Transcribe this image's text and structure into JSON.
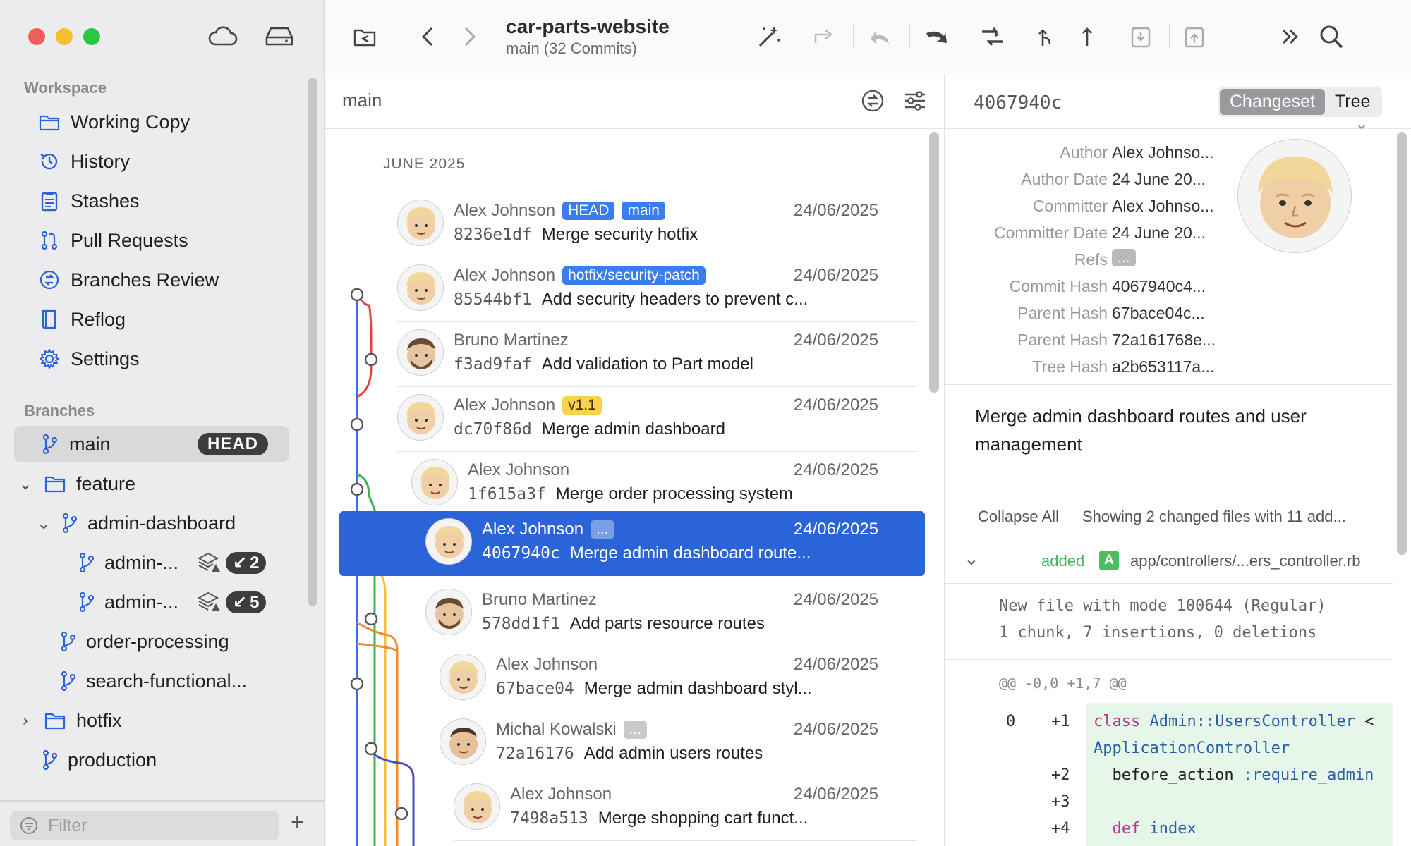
{
  "sidebar": {
    "workspace_label": "Workspace",
    "workspace_items": [
      {
        "label": "Working Copy"
      },
      {
        "label": "History"
      },
      {
        "label": "Stashes"
      },
      {
        "label": "Pull Requests"
      },
      {
        "label": "Branches Review"
      },
      {
        "label": "Reflog"
      },
      {
        "label": "Settings"
      }
    ],
    "branches_label": "Branches",
    "branches": {
      "main": {
        "label": "main",
        "badge": "HEAD"
      },
      "feature": {
        "label": "feature"
      },
      "admin_dashboard": {
        "label": "admin-dashboard"
      },
      "admin_sub1": {
        "label": "admin-...",
        "count": "2"
      },
      "admin_sub2": {
        "label": "admin-...",
        "count": "5"
      },
      "order_processing": {
        "label": "order-processing"
      },
      "search_functional": {
        "label": "search-functional..."
      },
      "hotfix": {
        "label": "hotfix"
      },
      "production": {
        "label": "production"
      }
    },
    "filter_placeholder": "Filter",
    "accent_color": "#2b63d9"
  },
  "toolbar": {
    "repo_name": "car-parts-website",
    "repo_subtitle": "main (32 Commits)"
  },
  "list": {
    "branch": "main",
    "month": "JUNE 2025",
    "commits": [
      {
        "author": "Alex Johnson",
        "tags": [
          "HEAD",
          "main"
        ],
        "date": "24/06/2025",
        "hash": "8236e1df",
        "message": "Merge security hotfix"
      },
      {
        "author": "Alex Johnson",
        "tags": [
          "hotfix/security-patch"
        ],
        "date": "24/06/2025",
        "hash": "85544bf1",
        "message": "Add security headers to prevent c..."
      },
      {
        "author": "Bruno Martinez",
        "tags": [],
        "date": "24/06/2025",
        "hash": "f3ad9faf",
        "message": "Add validation to Part model"
      },
      {
        "author": "Alex Johnson",
        "tags": [
          "v1.1"
        ],
        "date": "24/06/2025",
        "hash": "dc70f86d",
        "message": "Merge admin dashboard"
      },
      {
        "author": "Alex Johnson",
        "tags": [],
        "date": "24/06/2025",
        "hash": "1f615a3f",
        "message": "Merge order processing system"
      },
      {
        "author": "Alex Johnson",
        "tags": [
          "..."
        ],
        "date": "24/06/2025",
        "hash": "4067940c",
        "message": "Merge admin dashboard route..."
      },
      {
        "author": "Bruno Martinez",
        "tags": [],
        "date": "24/06/2025",
        "hash": "578dd1f1",
        "message": "Add parts resource routes"
      },
      {
        "author": "Alex Johnson",
        "tags": [],
        "date": "24/06/2025",
        "hash": "67bace04",
        "message": "Merge admin dashboard styl..."
      },
      {
        "author": "Michal Kowalski",
        "tags": [
          "..."
        ],
        "date": "24/06/2025",
        "hash": "72a16176",
        "message": "Add admin users routes"
      },
      {
        "author": "Alex Johnson",
        "tags": [],
        "date": "24/06/2025",
        "hash": "7498a513",
        "message": "Merge shopping cart funct..."
      }
    ]
  },
  "detail": {
    "hash": "4067940c",
    "tab_changeset": "Changeset",
    "tab_tree": "Tree",
    "meta": [
      {
        "label": "Author",
        "value": "Alex Johnso..."
      },
      {
        "label": "Author Date",
        "value": "24 June 20..."
      },
      {
        "label": "Committer",
        "value": "Alex Johnso..."
      },
      {
        "label": "Committer Date",
        "value": "24 June 20..."
      },
      {
        "label": "Refs",
        "value": "..."
      },
      {
        "label": "Commit Hash",
        "value": "4067940c4..."
      },
      {
        "label": "Parent Hash",
        "value": "67bace04c..."
      },
      {
        "label": "Parent Hash",
        "value": "72a161768e..."
      },
      {
        "label": "Tree Hash",
        "value": "a2b653117a..."
      }
    ],
    "message": "Merge admin dashboard routes and user management",
    "collapse_all": "Collapse All",
    "showing": "Showing 2 changed files with 11 add...",
    "file_status": "added",
    "file_badge": "A",
    "file_path": "app/controllers/...ers_controller.rb",
    "file_mode": "New file with mode 100644 (Regular)",
    "file_stats": "1 chunk, 7 insertions, 0 deletions",
    "hunk_header": "@@ -0,0 +1,7 @@",
    "code": {
      "old_ln_1": "0",
      "new_ln": [
        "+1",
        "+2",
        "+3",
        "+4"
      ],
      "line1_kw": "class",
      "line1_const": "Admin::UsersController",
      "line1_rest": " <",
      "line1b": "ApplicationController",
      "line2_plain": "  before_action ",
      "line2_sym": ":require_admin",
      "line4_kw": "  def",
      "line4_name": " index"
    }
  }
}
